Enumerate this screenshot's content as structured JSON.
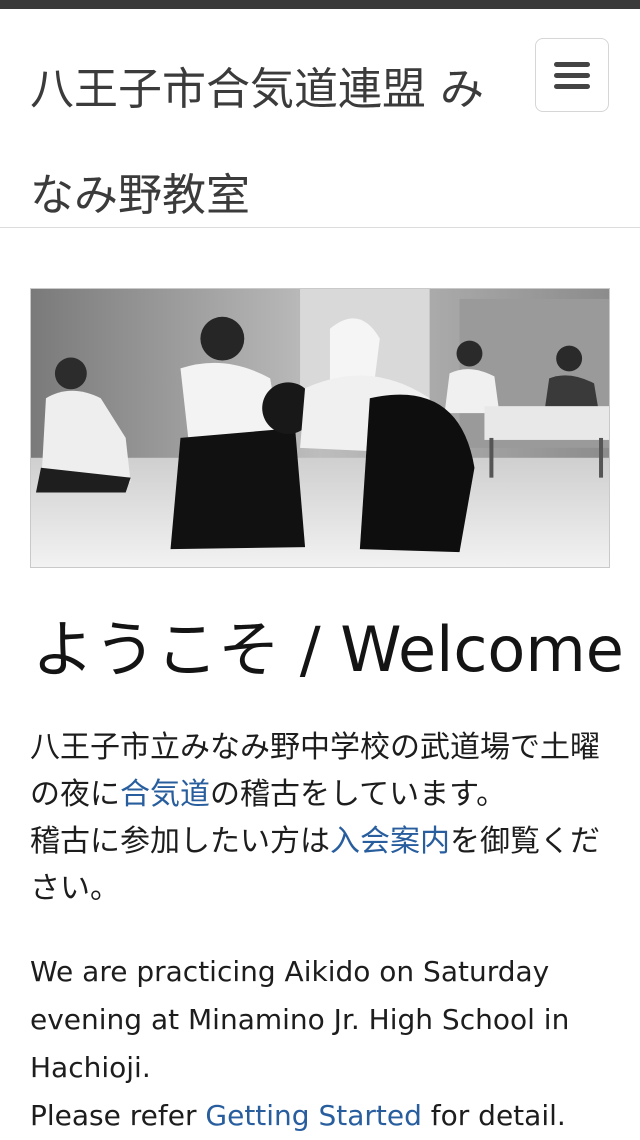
{
  "navbar": {
    "brand": "八王子市合気道連盟 みなみ野教室",
    "toggle_icon": "hamburger-menu-icon"
  },
  "hero": {
    "alt": "Aikido practice photo"
  },
  "main": {
    "heading": "ようこそ / Welcome",
    "ja": {
      "text1": "八王子市立みなみ野中学校の武道場で土曜の夜に",
      "link1": "合気道",
      "text2": "の稽古をしています。",
      "text3": "稽古に参加したい方は",
      "link2": "入会案内",
      "text4": "を御覧ください。"
    },
    "en": {
      "text1": "We are practicing Aikido on Saturday evening at Minamino Jr. High School in Hachioji.",
      "text2": "Please refer ",
      "link": "Getting Started",
      "text3": " for detail."
    }
  },
  "colors": {
    "link": "#285e9e",
    "topbar": "#3a3a3a"
  }
}
